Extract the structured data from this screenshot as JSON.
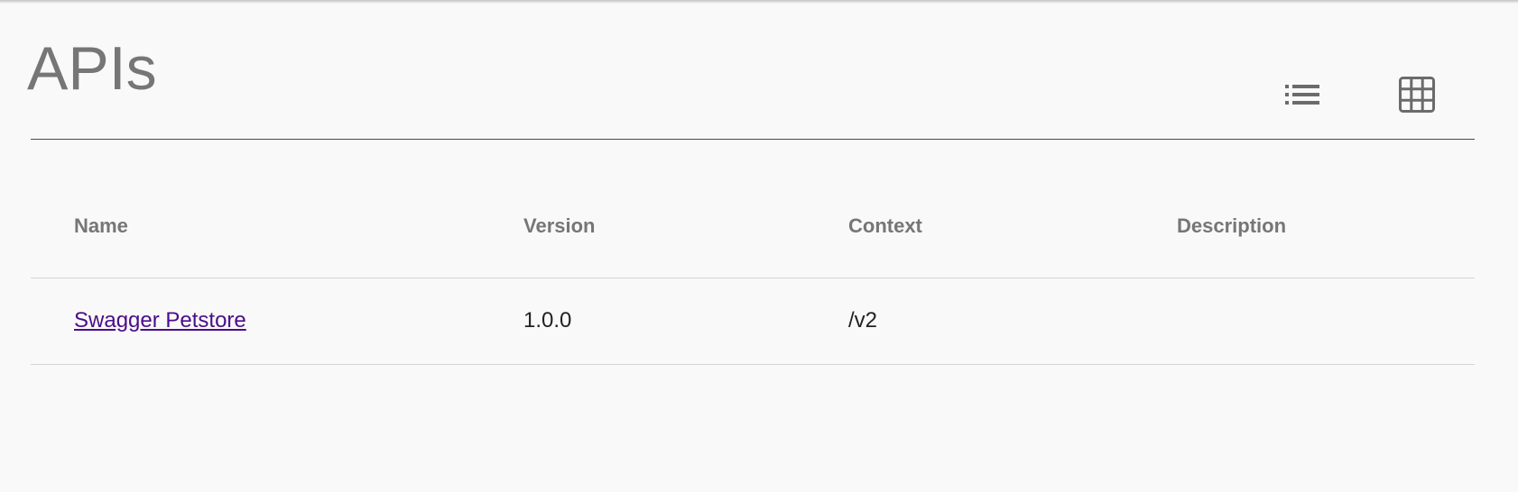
{
  "page": {
    "title": "APIs"
  },
  "toolbar": {
    "list_view_icon": "list-view-icon",
    "grid_view_icon": "grid-view-icon"
  },
  "table": {
    "columns": [
      "Name",
      "Version",
      "Context",
      "Description"
    ],
    "rows": [
      {
        "name": "Swagger Petstore",
        "version": "1.0.0",
        "context": "/v2",
        "description": ""
      }
    ]
  },
  "colors": {
    "background": "#f9f9f9",
    "title": "#767676",
    "link": "#4a0d8a",
    "divider": "#d4d4d4",
    "header_rule": "#4a4a4a"
  }
}
